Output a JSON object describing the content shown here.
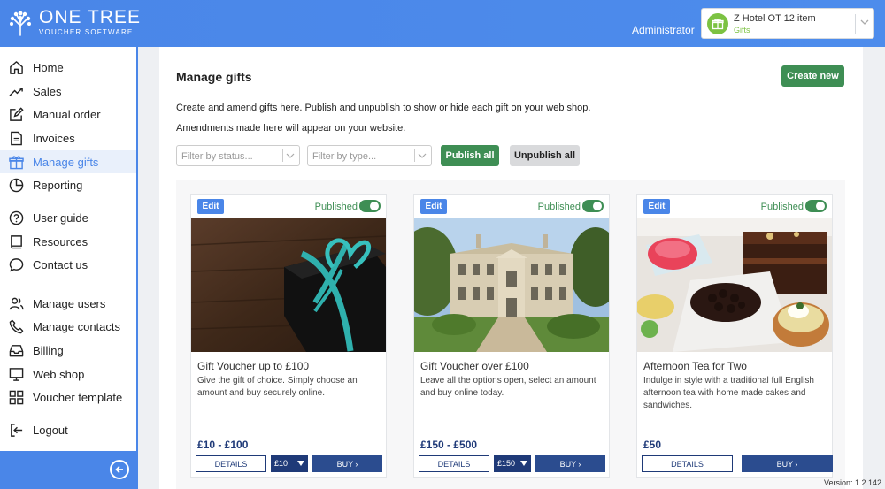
{
  "header": {
    "logo_title": "ONE TREE",
    "logo_sub": "VOUCHER SOFTWARE",
    "user": "Administrator",
    "hotel_selector": {
      "name": "Z Hotel OT 12 item",
      "sub": "Gifts"
    }
  },
  "sidebar": {
    "items": [
      {
        "label": "Home",
        "icon": "home-icon"
      },
      {
        "label": "Sales",
        "icon": "trend-icon"
      },
      {
        "label": "Manual order",
        "icon": "edit-icon"
      },
      {
        "label": "Invoices",
        "icon": "document-icon"
      },
      {
        "label": "Manage gifts",
        "icon": "gift-icon",
        "active": true
      },
      {
        "label": "Reporting",
        "icon": "pie-chart-icon"
      },
      {
        "label": "User guide",
        "icon": "help-icon"
      },
      {
        "label": "Resources",
        "icon": "book-icon"
      },
      {
        "label": "Contact us",
        "icon": "chat-icon"
      },
      {
        "label": "Manage users",
        "icon": "users-icon"
      },
      {
        "label": "Manage contacts",
        "icon": "phone-icon"
      },
      {
        "label": "Billing",
        "icon": "inbox-icon"
      },
      {
        "label": "Web shop",
        "icon": "monitor-icon"
      },
      {
        "label": "Voucher template",
        "icon": "grid-icon"
      },
      {
        "label": "Logout",
        "icon": "logout-icon"
      }
    ]
  },
  "main": {
    "title": "Manage gifts",
    "create_label": "Create new",
    "desc1": "Create and amend gifts here. Publish and unpublish to show or hide each gift on your web shop.",
    "desc2": "Amendments made here will appear on your website.",
    "filter_status_placeholder": "Filter by status...",
    "filter_type_placeholder": "Filter by type...",
    "publish_all_label": "Publish all",
    "unpublish_all_label": "Unpublish all"
  },
  "cards": [
    {
      "edit_label": "Edit",
      "status": "Published",
      "title": "Gift Voucher up to £100",
      "desc": "Give the gift of choice. Simply choose an amount and buy securely online.",
      "price": "£10 - £100",
      "details_label": "DETAILS",
      "amount": "£10",
      "buy_label": "BUY"
    },
    {
      "edit_label": "Edit",
      "status": "Published",
      "title": "Gift Voucher over £100",
      "desc": "Leave all the options open, select an amount and buy online today.",
      "price": "£150 - £500",
      "details_label": "DETAILS",
      "amount": "£150",
      "buy_label": "BUY"
    },
    {
      "edit_label": "Edit",
      "status": "Published",
      "title": "Afternoon Tea for Two",
      "desc": "Indulge in style with a traditional full English afternoon tea with home made cakes and sandwiches.",
      "price": "£50",
      "details_label": "DETAILS",
      "buy_label": "BUY"
    }
  ],
  "footer": {
    "version": "Version: 1.2.142"
  },
  "colors": {
    "brand_blue": "#4a86e8",
    "green": "#3e8e54",
    "navy": "#1f3a78"
  }
}
